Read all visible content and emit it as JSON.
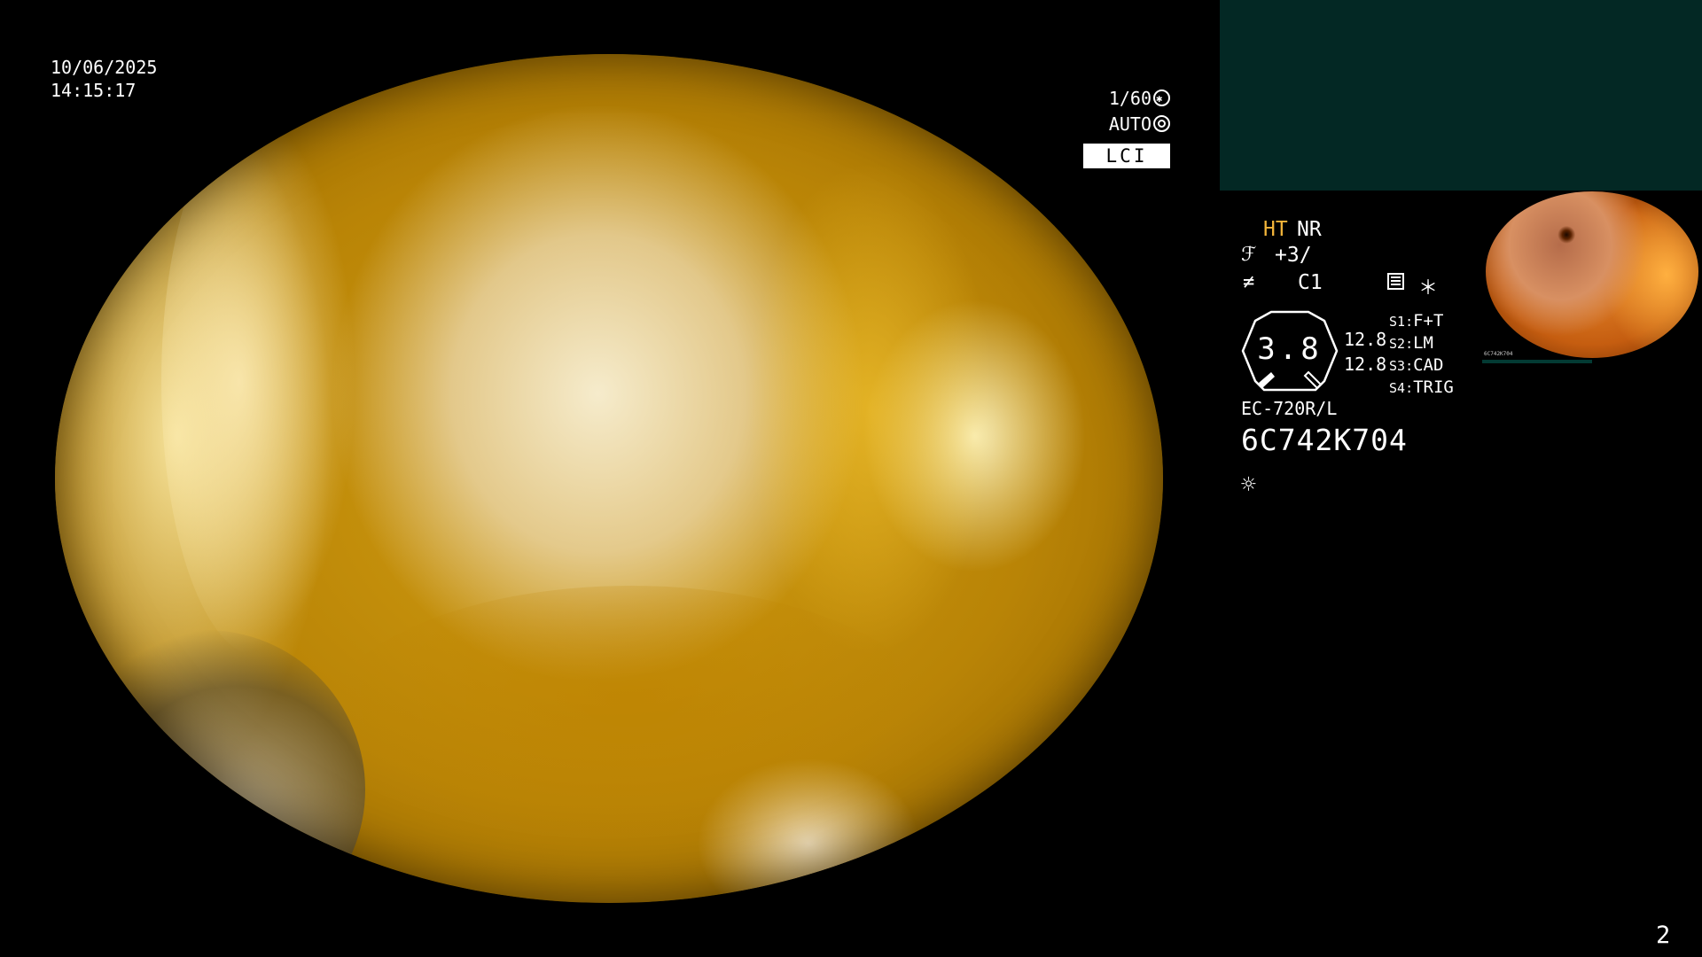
{
  "main_view": {
    "date": "10/06/2025",
    "time": "14:15:17",
    "shutter": "1/60",
    "exposure": "AUTO",
    "mode_badge": "LCI"
  },
  "panel": {
    "ht_label": "HT",
    "nr_label": "NR",
    "enhancement": "+3/",
    "color_mode": "C1",
    "star": "＊",
    "zoom_value": "3.8",
    "distance_top": "12.8",
    "distance_bottom": "12.8",
    "switches": [
      {
        "key": "S1",
        "value": "F+T"
      },
      {
        "key": "S2",
        "value": "LM"
      },
      {
        "key": "S3",
        "value": "CAD"
      },
      {
        "key": "S4",
        "value": "TRIG"
      }
    ],
    "scope_model": "EC-720R/L",
    "serial": "6C742K704",
    "light_icon": "sun-icon"
  },
  "thumbnail": {
    "id": "6C742K704"
  },
  "page_number": "2",
  "colors": {
    "panel_top": "#032824",
    "ht_accent": "#f3b53a",
    "mucosa": "#c8960a"
  }
}
